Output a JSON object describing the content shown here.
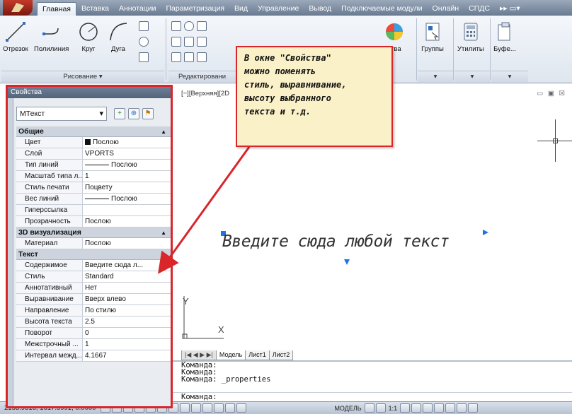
{
  "tabs": [
    "Главная",
    "Вставка",
    "Аннотации",
    "Параметризация",
    "Вид",
    "Управление",
    "Вывод",
    "Подключаемые модули",
    "Онлайн",
    "СПДС"
  ],
  "ribbon": {
    "tools": {
      "line": "Отрезок",
      "polyline": "Полилиния",
      "circle": "Круг",
      "arc": "Дуга",
      "props_partial": "ства",
      "groups": "Группы",
      "utilities": "Утилиты",
      "clipboard": "Буфе..."
    },
    "panels": {
      "draw": "Рисование ▾",
      "modify": "Редактировани"
    }
  },
  "viewport": {
    "label": "[−][Верхняя][2D",
    "controls": "▭ ▣ ☒"
  },
  "drawing": {
    "mtext": "Введите сюда любой текст"
  },
  "layout_tabs": {
    "nav": "|◀ ◀ ▶ ▶|",
    "model": "Модель",
    "sheet1": "Лист1",
    "sheet2": "Лист2"
  },
  "callout": {
    "line1": "В окне \"Свойства\"",
    "line2": "можно поменять",
    "line3": "стиль, выравнивание,",
    "line4": "высоту выбранного",
    "line5": "текста и т.д."
  },
  "properties": {
    "title": "Свойства",
    "object_type": "МТекст",
    "categories": {
      "general": "Общие",
      "viz3d": "3D визуализация",
      "text": "Текст"
    },
    "general_rows": [
      {
        "k": "Цвет",
        "v": "Послою"
      },
      {
        "k": "Слой",
        "v": "VPORTS"
      },
      {
        "k": "Тип линий",
        "v": "Послою"
      },
      {
        "k": "Масштаб типа л...",
        "v": "1"
      },
      {
        "k": "Стиль печати",
        "v": "Поцвету"
      },
      {
        "k": "Вес линий",
        "v": "Послою"
      },
      {
        "k": "Гиперссылка",
        "v": ""
      },
      {
        "k": "Прозрачность",
        "v": "Послою"
      }
    ],
    "viz3d_rows": [
      {
        "k": "Материал",
        "v": "Послою"
      }
    ],
    "text_rows": [
      {
        "k": "Содержимое",
        "v": "Введите сюда л..."
      },
      {
        "k": "Стиль",
        "v": "Standard"
      },
      {
        "k": "Аннотативный",
        "v": "Нет"
      },
      {
        "k": "Выравнивание",
        "v": "Вверх влево"
      },
      {
        "k": "Направление",
        "v": "По стилю"
      },
      {
        "k": "Высота текста",
        "v": "2.5"
      },
      {
        "k": "Поворот",
        "v": "0"
      },
      {
        "k": "Межстрочный ...",
        "v": "1"
      },
      {
        "k": "Интервал межд...",
        "v": "4.1667"
      }
    ]
  },
  "command": {
    "lines": [
      "Команда:",
      "Команда:",
      "Команда:  _properties"
    ],
    "prompt": "Команда:"
  },
  "status": {
    "coords": "2153.9316, 1617.5991, 0.0000",
    "model": "МОДЕЛЬ",
    "scale": "1:1"
  },
  "colors": {
    "highlight": "#d8262a",
    "callout_bg": "#fbf1c8",
    "grip": "#1e73e6"
  }
}
